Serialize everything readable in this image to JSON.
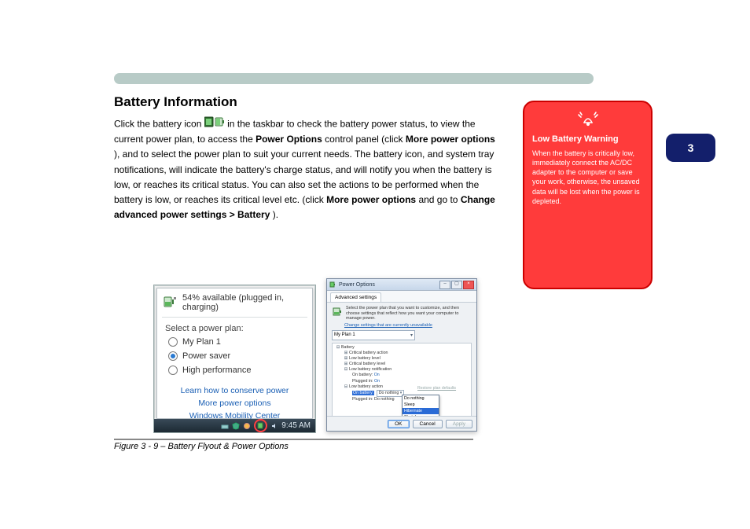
{
  "header": {
    "title": "Battery Information"
  },
  "page_tab": "3",
  "body": {
    "p1_a": "Click the battery icon ",
    "p1_b": " in the taskbar to check the battery power status, to view the current power plan, to access the ",
    "p1_c": " control panel (click ",
    "p1_d": "), and to select the power plan to suit your current needs. The battery icon, and system tray notifications, will indicate the battery's charge status, and will notify you when the battery is low, or reaches its critical status. You can also set the actions to be performed when the battery is low, or reaches its critical level etc. (click ",
    "p1_e": " and go to ",
    "p1_f": "Change advanced power settings > Battery",
    "p1_g": ").",
    "bold_power_options": "Power Options",
    "bold_more_power": "More power options"
  },
  "warning": {
    "title": "Low Battery Warning",
    "text": "When the battery is critically low, immediately connect the AC/DC adapter to the computer or save your work, otherwise, the unsaved data will be lost when the power is depleted."
  },
  "fig_caption": "Figure 3 - 9 – Battery Flyout & Power Options",
  "flyout": {
    "status": "54% available (plugged in, charging)",
    "select_label": "Select a power plan:",
    "plans": [
      {
        "label": "My Plan 1",
        "checked": false
      },
      {
        "label": "Power saver",
        "checked": true
      },
      {
        "label": "High performance",
        "checked": false
      }
    ],
    "links": {
      "learn": "Learn how to conserve power",
      "more": "More power options",
      "wmc": "Windows Mobility Center"
    },
    "time": "9:45 AM"
  },
  "dialog": {
    "title": "Power Options",
    "tab": "Advanced settings",
    "intro": "Select the power plan that you want to customize, and then choose settings that reflect how you want your computer to manage power.",
    "change_link": "Change settings that are currently unavailable",
    "plan_combo": "My Plan 1",
    "tree": {
      "battery": "Battery",
      "crit_action": "Critical battery action",
      "low_level": "Low battery level",
      "crit_level": "Critical battery level",
      "low_notif": "Low battery notification",
      "on_batt": "On battery:",
      "on_batt_val": "On",
      "plugged": "Plugged in:",
      "plugged_val": "On",
      "low_action": "Low battery action",
      "on_batt2": "On battery:",
      "on_batt2_val": "Do nothing",
      "plugged2": "Plugged in:",
      "plugged2_val": "Do nothing"
    },
    "dropdown": [
      "Do nothing",
      "Sleep",
      "Hibernate",
      "Shut down"
    ],
    "restore": "Restore plan defaults",
    "buttons": {
      "ok": "OK",
      "cancel": "Cancel",
      "apply": "Apply"
    }
  }
}
